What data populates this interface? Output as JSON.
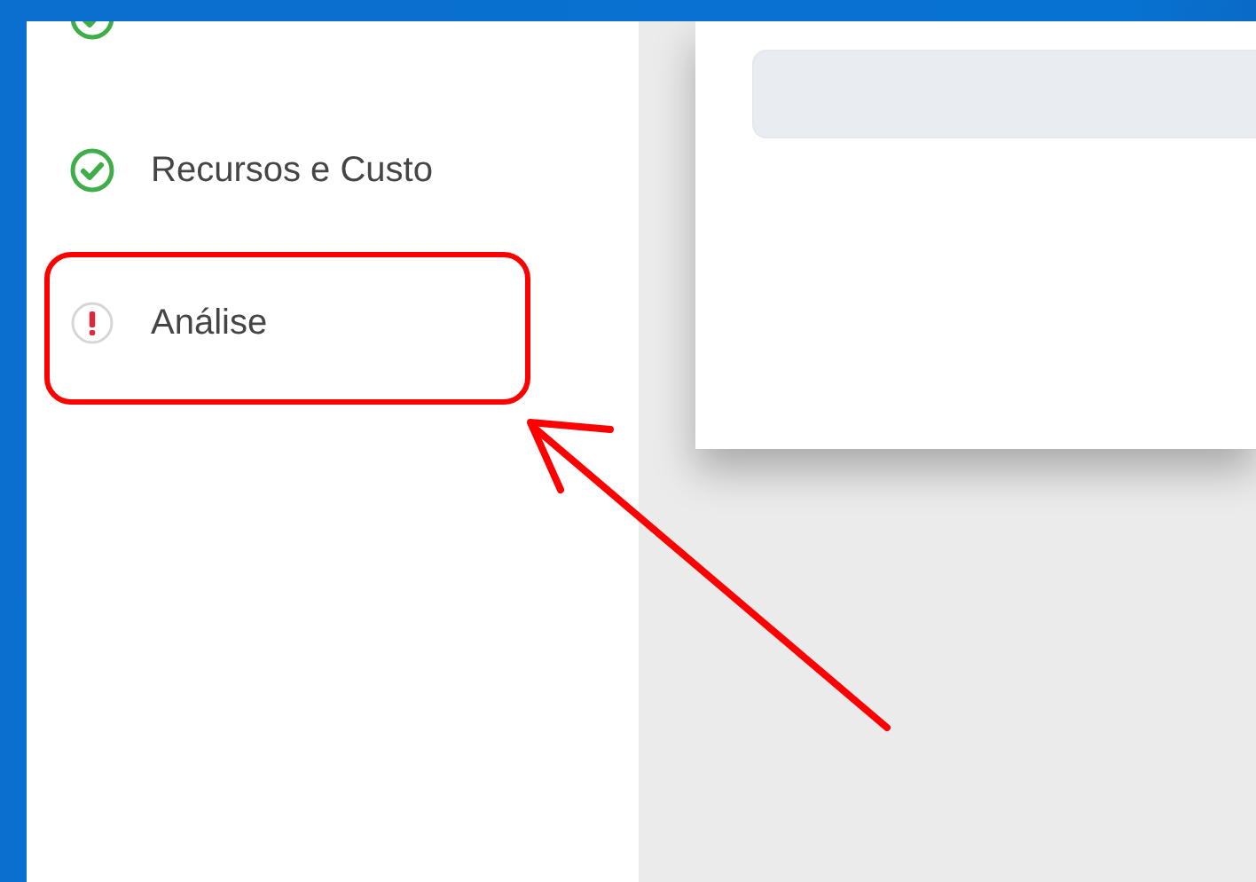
{
  "steps": [
    {
      "done": true,
      "annotated": false
    },
    {
      "label": "Recursos e Custo",
      "done": true,
      "annotated": false
    },
    {
      "label": "Análise",
      "done": false,
      "annotated": true
    }
  ]
}
